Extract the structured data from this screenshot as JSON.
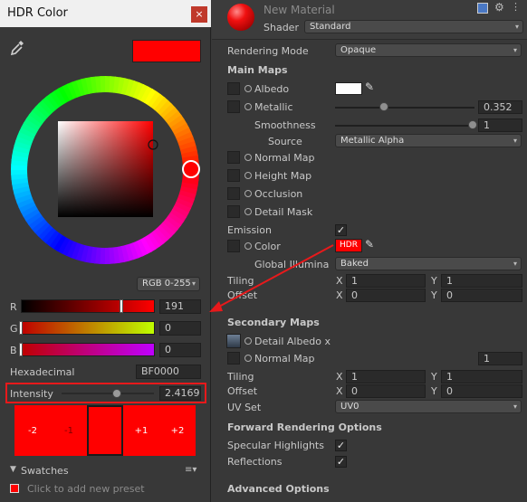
{
  "hdr_window": {
    "title": "HDR Color",
    "close": "×",
    "mode": "RGB 0-255",
    "channels": [
      {
        "label": "R",
        "value": "191",
        "fill": 0.75
      },
      {
        "label": "G",
        "value": "0",
        "fill": 0.0
      },
      {
        "label": "B",
        "value": "0",
        "fill": 0.0
      }
    ],
    "hex_label": "Hexadecimal",
    "hex_value": "BF0000",
    "intensity_label": "Intensity",
    "intensity_value": "2.4169",
    "intensity_fill": 0.6,
    "preview_steps": [
      "-2",
      "-1",
      "+1",
      "+2"
    ],
    "swatches_label": "Swatches",
    "add_preset": "Click to add new preset",
    "colors": {
      "main": "#ff0000",
      "highlight": "#e8191b"
    }
  },
  "inspector": {
    "material_name": "New Material",
    "shader_label": "Shader",
    "shader_value": "Standard",
    "rendering_mode_label": "Rendering Mode",
    "rendering_mode_value": "Opaque",
    "main_maps": "Main Maps",
    "albedo": "Albedo",
    "metallic": "Metallic",
    "metallic_value": "0.352",
    "metallic_fill": 0.352,
    "smoothness": "Smoothness",
    "smoothness_value": "1",
    "smoothness_fill": 1.0,
    "source": "Source",
    "source_value": "Metallic Alpha",
    "normal_map": "Normal Map",
    "height_map": "Height Map",
    "occlusion": "Occlusion",
    "detail_mask": "Detail Mask",
    "emission": "Emission",
    "color": "Color",
    "hdr_badge": "HDR",
    "global_illum": "Global Illumina",
    "global_illum_value": "Baked",
    "tiling": "Tiling",
    "offset": "Offset",
    "main_tiling": {
      "x": "1",
      "y": "1"
    },
    "main_offset": {
      "x": "0",
      "y": "0"
    },
    "x_label": "X",
    "y_label": "Y",
    "secondary_maps": "Secondary Maps",
    "detail_albedo": "Detail Albedo x",
    "sec_normal_map": "Normal Map",
    "sec_normal_value": "1",
    "sec_tiling": {
      "x": "1",
      "y": "1"
    },
    "sec_offset": {
      "x": "0",
      "y": "0"
    },
    "uv_set": "UV Set",
    "uv_set_value": "UV0",
    "forward_options": "Forward Rendering Options",
    "specular_highlights": "Specular Highlights",
    "reflections": "Reflections",
    "advanced_options": "Advanced Options"
  }
}
